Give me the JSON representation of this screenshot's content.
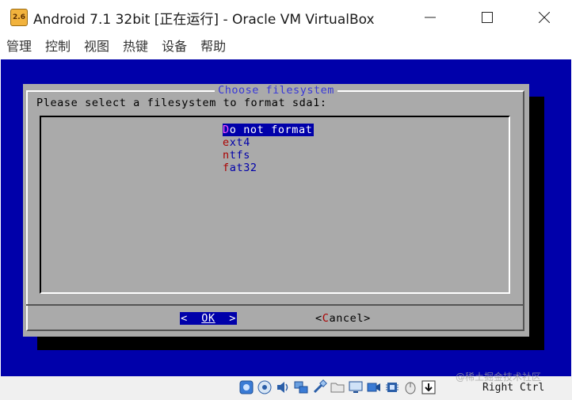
{
  "window": {
    "icon_text": "2.6",
    "title": "Android 7.1 32bit [正在运行] - Oracle VM VirtualBox"
  },
  "menu": {
    "items": [
      "管理",
      "控制",
      "视图",
      "热键",
      "设备",
      "帮助"
    ]
  },
  "dialog": {
    "title": "Choose filesystem",
    "prompt": "Please select a filesystem to format sda1:",
    "options": [
      {
        "hotkey": "D",
        "rest": "o not format",
        "selected": true
      },
      {
        "hotkey": "e",
        "rest": "xt4",
        "selected": false
      },
      {
        "hotkey": "n",
        "rest": "tfs",
        "selected": false
      },
      {
        "hotkey": "f",
        "rest": "at32",
        "selected": false
      }
    ],
    "ok_button": {
      "left": "<  ",
      "hotkey": "O",
      "rest": "K",
      "right": "  >"
    },
    "cancel_button": {
      "left": "<",
      "hotkey": "C",
      "rest": "ancel",
      "right": ">"
    }
  },
  "statusbar": {
    "icons": [
      "hard-disk-icon",
      "optical-drive-icon",
      "audio-icon",
      "network-icon",
      "usb-icon",
      "shared-folder-icon",
      "display-icon",
      "video-capture-icon",
      "cpu-icon",
      "mouse-integration-icon",
      "host-key-icon"
    ],
    "host_key": "Right Ctrl"
  },
  "watermark": "@稀土掘金技术社区",
  "colors": {
    "vm_background": "#0000aa",
    "dialog_gray": "#aaaaaa",
    "highlight": "#0000aa",
    "hotkey_red": "#aa0000",
    "title_blue": "#3838d8"
  }
}
